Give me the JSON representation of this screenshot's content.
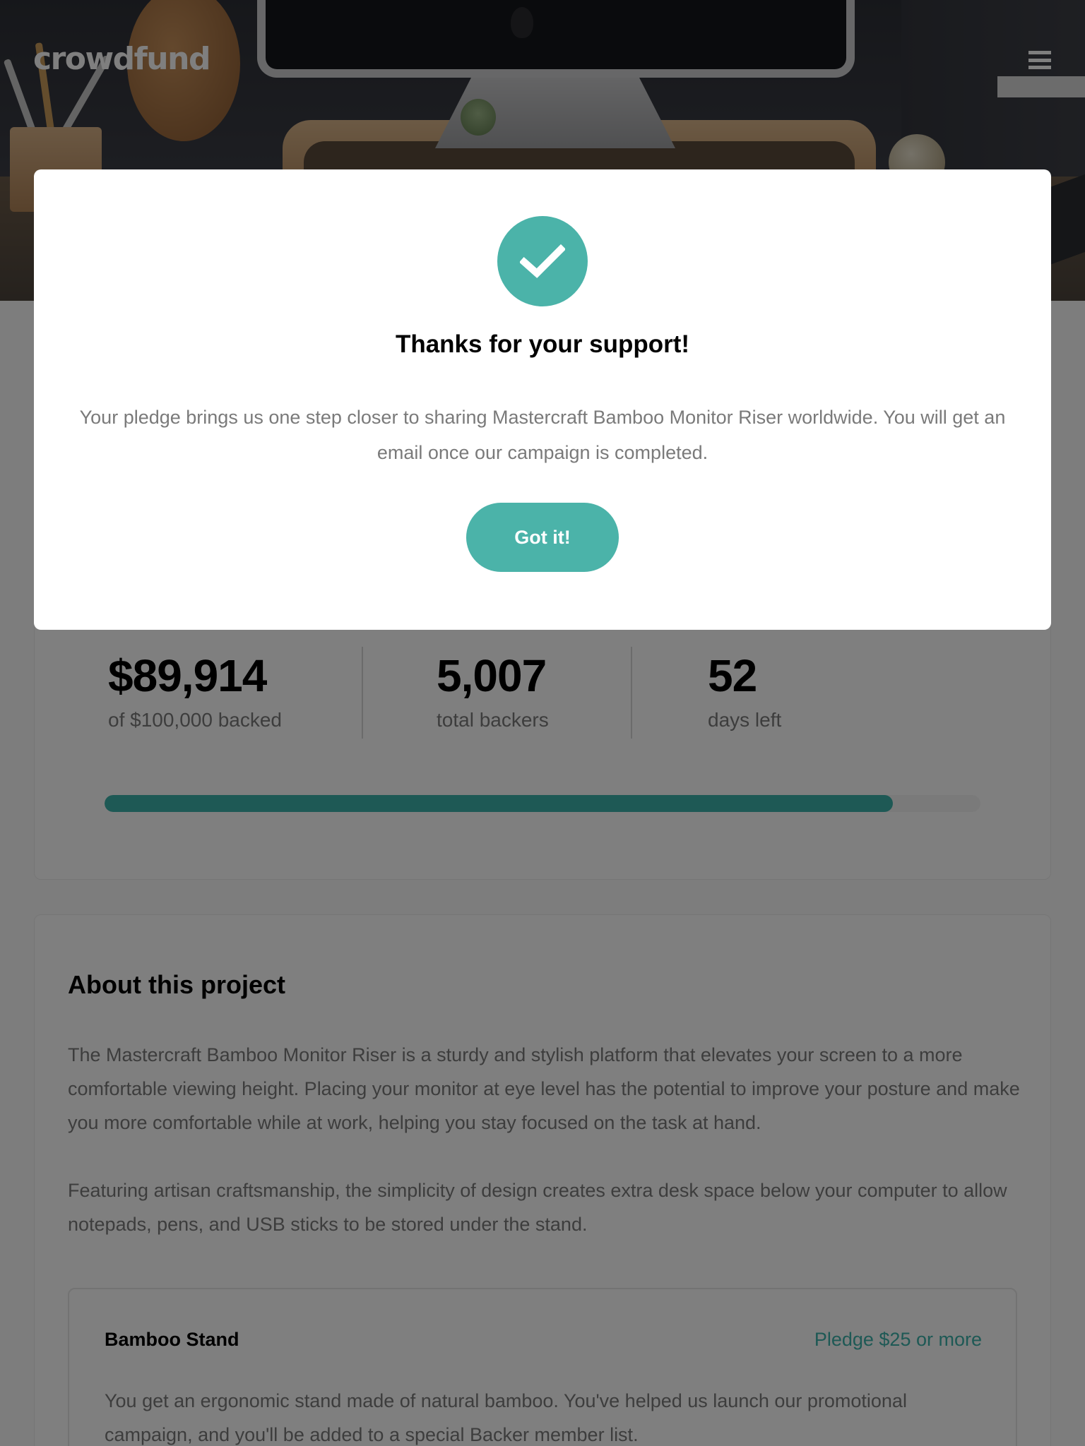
{
  "header": {
    "logo": "crowdfund",
    "menu_icon": "hamburger-icon"
  },
  "stats": {
    "backed_amount": "$89,914",
    "backed_label": "of $100,000 backed",
    "backers_count": "5,007",
    "backers_label": "total backers",
    "days_left": "52",
    "days_label": "days left",
    "progress_fraction": 0.9
  },
  "about": {
    "heading": "About this project",
    "paragraph_1": "The Mastercraft Bamboo Monitor Riser is a sturdy and stylish platform that elevates your screen to a more comfortable viewing height. Placing your monitor at eye level has the potential to improve your posture and make you more comfortable while at work, helping you stay focused on the task at hand.",
    "paragraph_2": "Featuring artisan craftsmanship, the simplicity of design creates extra desk space below your computer to allow notepads, pens, and USB sticks to be stored under the stand."
  },
  "reward": {
    "name": "Bamboo Stand",
    "pledge": "Pledge $25 or more",
    "description": "You get an ergonomic stand made of natural bamboo. You've helped us launch our promotional campaign, and you'll be added to a special Backer member list."
  },
  "modal": {
    "icon": "check-icon",
    "title": "Thanks for your support!",
    "text": "Your pledge brings us one step closer to sharing Mastercraft Bamboo Monitor Riser worldwide. You will get an email once our campaign is completed.",
    "button_label": "Got it!"
  },
  "colors": {
    "accent": "#3cb3ab",
    "text_muted": "#7a7a7a",
    "overlay": "rgba(0,0,0,0.5)"
  }
}
